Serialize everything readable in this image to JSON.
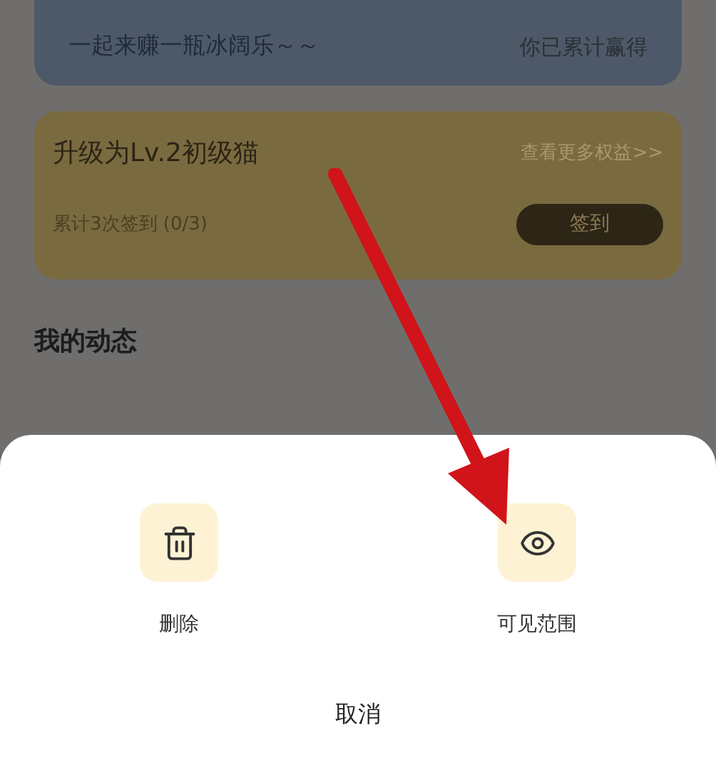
{
  "reward_card": {
    "slogan": "一起来赚一瓶冰阔乐～～",
    "total_label": "你已累计赢得"
  },
  "level_card": {
    "title": "升级为Lv.2初级猫",
    "link": "查看更多权益>>",
    "progress": "累计3次签到 (0/3)",
    "button": "签到"
  },
  "section_title": "我的动态",
  "action_sheet": {
    "actions": [
      {
        "kind": "delete",
        "label": "删除"
      },
      {
        "kind": "visibility",
        "label": "可见范围"
      }
    ],
    "cancel": "取消"
  }
}
